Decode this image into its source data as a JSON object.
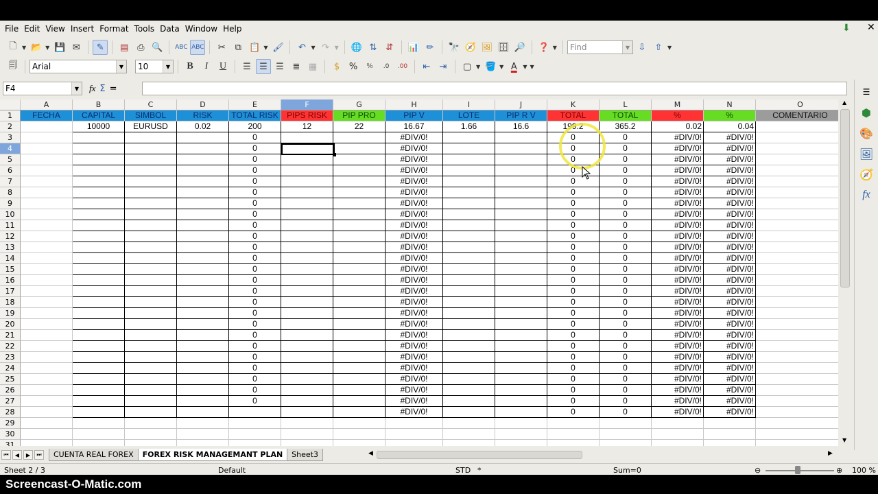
{
  "menu": [
    "File",
    "Edit",
    "View",
    "Insert",
    "Format",
    "Tools",
    "Data",
    "Window",
    "Help"
  ],
  "toolbar": {
    "find_placeholder": "Find",
    "font_name": "Arial",
    "font_size": "10",
    "bold": "B",
    "italic": "I",
    "underline": "U"
  },
  "formula_bar": {
    "name_box": "F4",
    "content": ""
  },
  "columns": [
    {
      "letter": "A",
      "width": 76
    },
    {
      "letter": "B",
      "width": 76
    },
    {
      "letter": "C",
      "width": 76
    },
    {
      "letter": "D",
      "width": 76
    },
    {
      "letter": "E",
      "width": 76
    },
    {
      "letter": "F",
      "width": 76
    },
    {
      "letter": "G",
      "width": 76
    },
    {
      "letter": "H",
      "width": 84
    },
    {
      "letter": "I",
      "width": 76
    },
    {
      "letter": "J",
      "width": 76
    },
    {
      "letter": "K",
      "width": 76
    },
    {
      "letter": "L",
      "width": 76
    },
    {
      "letter": "M",
      "width": 76
    },
    {
      "letter": "N",
      "width": 76
    },
    {
      "letter": "O",
      "width": 130
    }
  ],
  "header_row": [
    "FECHA",
    "CAPITAL",
    "SIMBOL",
    "RISK",
    "TOTAL RISK",
    "PIPS RISK",
    "PIP PRO",
    "PIP V",
    "LOTE",
    "PIP R V",
    "TOTAL",
    "TOTAL",
    "%",
    "%",
    "COMENTARIO"
  ],
  "header_colors": [
    "hb",
    "hb",
    "hb",
    "hb",
    "hb",
    "hr",
    "hg",
    "hb",
    "hb",
    "hb",
    "hr",
    "hg",
    "hr",
    "hg",
    "hgr"
  ],
  "row2": [
    "",
    "10000",
    "EURUSD",
    "0.02",
    "200",
    "12",
    "22",
    "16.67",
    "1.66",
    "16.6",
    "199.2",
    "365.2",
    "0.02",
    "0.04",
    ""
  ],
  "row2_align": [
    "",
    "c",
    "c",
    "c",
    "c",
    "c",
    "c",
    "c",
    "c",
    "c",
    "c",
    "c",
    "r",
    "r",
    ""
  ],
  "filled_rows": {
    "E": "0",
    "H": "#DIV/0!",
    "K": "0",
    "L": "0",
    "M": "#DIV/0!",
    "N": "#DIV/0!"
  },
  "row_count": 31,
  "sheets": [
    "CUENTA REAL FOREX",
    "FOREX RISK MANAGEMANT PLAN",
    "Sheet3"
  ],
  "active_sheet": 1,
  "status": {
    "sheet": "Sheet 2 / 3",
    "style": "Default",
    "mode": "STD",
    "modified": "*",
    "sum": "Sum=0",
    "zoom": "100 %"
  },
  "watermark": "Screencast-O-Matic.com",
  "selection": {
    "column": "F",
    "row": 4
  }
}
